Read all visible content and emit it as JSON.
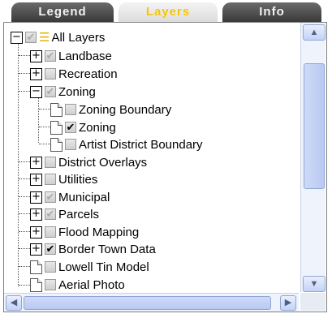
{
  "tabs": [
    {
      "label": "Legend",
      "active": false
    },
    {
      "label": "Layers",
      "active": true
    },
    {
      "label": "Info",
      "active": false
    }
  ],
  "tree": {
    "root": {
      "label": "All Layers",
      "expanded": true,
      "checked": "partial"
    },
    "items": [
      {
        "label": "Landbase",
        "type": "group",
        "expanded": false,
        "checked": "partial"
      },
      {
        "label": "Recreation",
        "type": "group",
        "expanded": false,
        "checked": "off"
      },
      {
        "label": "Zoning",
        "type": "group",
        "expanded": true,
        "checked": "partial"
      },
      {
        "label": "Zoning Boundary",
        "type": "layer",
        "checked": "off"
      },
      {
        "label": "Zoning",
        "type": "layer",
        "checked": "on"
      },
      {
        "label": "Artist District Boundary",
        "type": "layer",
        "checked": "off"
      },
      {
        "label": "District Overlays",
        "type": "group",
        "expanded": false,
        "checked": "off"
      },
      {
        "label": "Utilities",
        "type": "group",
        "expanded": false,
        "checked": "off"
      },
      {
        "label": "Municipal",
        "type": "group",
        "expanded": false,
        "checked": "partial"
      },
      {
        "label": "Parcels",
        "type": "group",
        "expanded": false,
        "checked": "partial"
      },
      {
        "label": "Flood Mapping",
        "type": "group",
        "expanded": false,
        "checked": "off"
      },
      {
        "label": "Border Town Data",
        "type": "group",
        "expanded": false,
        "checked": "on"
      },
      {
        "label": "Lowell Tin Model",
        "type": "layer",
        "checked": "off"
      },
      {
        "label": "Aerial Photo",
        "type": "layer",
        "checked": "off"
      }
    ]
  },
  "icons": {
    "expand": "plus-box",
    "collapse": "minus-box",
    "layer": "page-icon",
    "layers_stack": "layers-stack-icon",
    "scroll_up": "▲",
    "scroll_down": "▼",
    "scroll_left": "◀",
    "scroll_right": "▶"
  },
  "colors": {
    "active_tab_text": "#f7c300",
    "inactive_tab_bg": "#4a4a4a",
    "scrollbar": "#c3d2f6"
  }
}
